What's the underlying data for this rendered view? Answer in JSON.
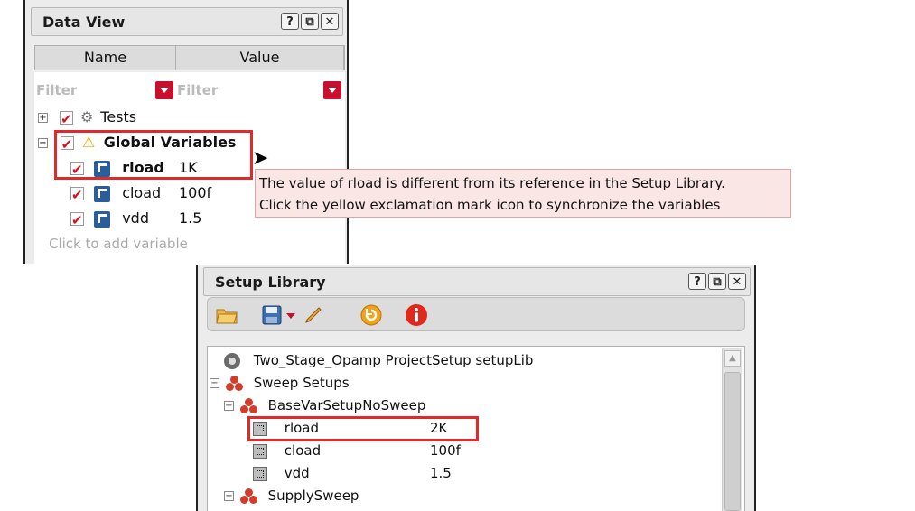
{
  "data_view": {
    "title": "Data View",
    "window_buttons": [
      "?",
      "⧉",
      "✕"
    ],
    "columns": [
      "Name",
      "Value"
    ],
    "filter_name_placeholder": "Filter",
    "filter_value_placeholder": "Filter",
    "tree": {
      "tests": "Tests",
      "global_variables": "Global Variables",
      "variables": [
        {
          "name": "rload",
          "value": "1K"
        },
        {
          "name": "cload",
          "value": "100f"
        },
        {
          "name": "vdd",
          "value": "1.5"
        }
      ],
      "add_variable": "Click to add variable"
    }
  },
  "tooltip": {
    "line1": "The value of rload is different from its reference in the Setup Library.",
    "line2": "Click the yellow exclamation mark icon to synchronize the variables"
  },
  "setup_library": {
    "title": "Setup Library",
    "window_buttons": [
      "?",
      "⧉",
      "✕"
    ],
    "tree": {
      "project_setup": "Two_Stage_Opamp ProjectSetup setupLib",
      "sweep_setups": "Sweep Setups",
      "base_setup": "BaseVarSetupNoSweep",
      "params": [
        {
          "name": "rload",
          "value": "2K"
        },
        {
          "name": "cload",
          "value": "100f"
        },
        {
          "name": "vdd",
          "value": "1.5"
        }
      ],
      "supply_sweep": "SupplySweep"
    }
  },
  "colors": {
    "highlight": "#e0292b",
    "check_red": "#d8101e",
    "tooltip_bg": "#fbe6e6"
  }
}
